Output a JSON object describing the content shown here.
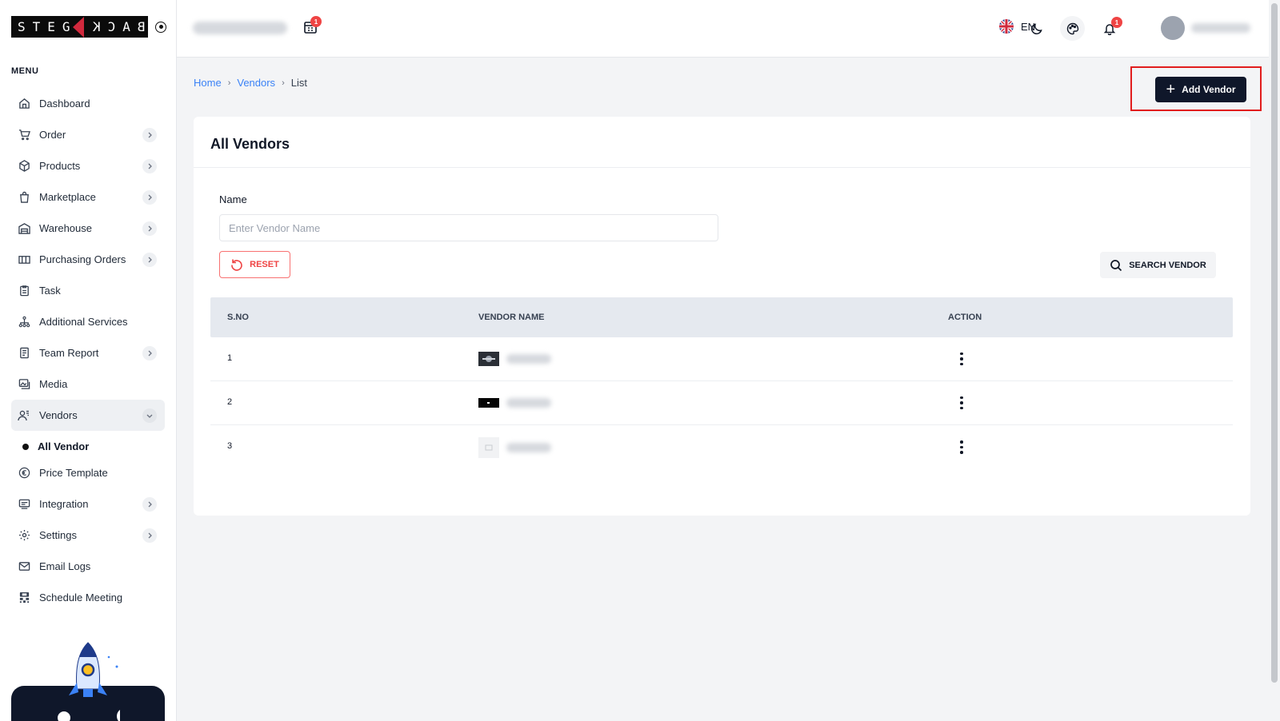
{
  "brand": {
    "left": "STEG",
    "right": "BACK"
  },
  "sidebar": {
    "menu_title": "MENU",
    "items": [
      {
        "label": "Dashboard",
        "icon": "home-icon",
        "chevron": false
      },
      {
        "label": "Order",
        "icon": "cart-icon",
        "chevron": true
      },
      {
        "label": "Products",
        "icon": "box-icon",
        "chevron": true
      },
      {
        "label": "Marketplace",
        "icon": "shopping-bag-icon",
        "chevron": true
      },
      {
        "label": "Warehouse",
        "icon": "warehouse-icon",
        "chevron": true
      },
      {
        "label": "Purchasing Orders",
        "icon": "truck-icon",
        "chevron": true
      },
      {
        "label": "Task",
        "icon": "clipboard-icon",
        "chevron": false
      },
      {
        "label": "Additional Services",
        "icon": "network-icon",
        "chevron": false
      },
      {
        "label": "Team Report",
        "icon": "report-icon",
        "chevron": true
      },
      {
        "label": "Media",
        "icon": "media-icon",
        "chevron": false
      },
      {
        "label": "Vendors",
        "icon": "users-icon",
        "chevron": true
      },
      {
        "label": "All Vendor"
      },
      {
        "label": "Price Template",
        "icon": "euro-icon",
        "chevron": false
      },
      {
        "label": "Integration",
        "icon": "integration-icon",
        "chevron": true
      },
      {
        "label": "Settings",
        "icon": "gear-icon",
        "chevron": true
      },
      {
        "label": "Email Logs",
        "icon": "mail-icon",
        "chevron": false
      },
      {
        "label": "Schedule Meeting",
        "icon": "meeting-icon",
        "chevron": false
      }
    ]
  },
  "topbar": {
    "calendar_badge": "1",
    "language": "EN",
    "notification_badge": "1"
  },
  "breadcrumb": {
    "home": "Home",
    "section": "Vendors",
    "current": "List"
  },
  "add_vendor_label": "Add Vendor",
  "card": {
    "title": "All Vendors",
    "name_label": "Name",
    "name_placeholder": "Enter Vendor Name",
    "reset_label": "RESET",
    "search_label": "SEARCH VENDOR"
  },
  "table": {
    "headers": {
      "sno": "S.NO",
      "vendor_name": "VENDOR NAME",
      "action": "ACTION"
    },
    "rows": [
      {
        "sno": "1"
      },
      {
        "sno": "2"
      },
      {
        "sno": "3"
      }
    ]
  },
  "colors": {
    "accent": "#0f172a",
    "link": "#3b82f6",
    "danger": "#ef4444",
    "highlight": "#e11d1d"
  }
}
